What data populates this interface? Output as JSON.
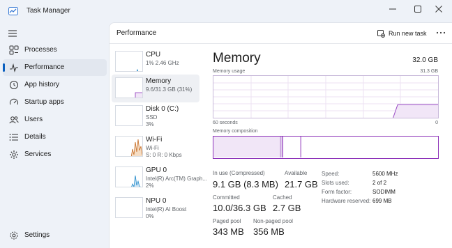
{
  "window": {
    "title": "Task Manager"
  },
  "sidebar": {
    "items": [
      {
        "label": "Processes"
      },
      {
        "label": "Performance"
      },
      {
        "label": "App history"
      },
      {
        "label": "Startup apps"
      },
      {
        "label": "Users"
      },
      {
        "label": "Details"
      },
      {
        "label": "Services"
      }
    ],
    "settings_label": "Settings",
    "active_item": "Performance"
  },
  "header": {
    "title": "Performance",
    "run_new_task": "Run new task"
  },
  "tiles": [
    {
      "name": "CPU",
      "line1": "1%  2.46 GHz",
      "line2": ""
    },
    {
      "name": "Memory",
      "line1": "9.6/31.3 GB (31%)",
      "line2": ""
    },
    {
      "name": "Disk 0 (C:)",
      "line1": "SSD",
      "line2": "3%"
    },
    {
      "name": "Wi-Fi",
      "line1": "Wi-Fi",
      "line2": "S: 0  R: 0 Kbps"
    },
    {
      "name": "GPU 0",
      "line1": "Intel(R) Arc(TM) Graph...",
      "line2": "2%"
    },
    {
      "name": "NPU 0",
      "line1": "Intel(R) AI Boost",
      "line2": "0%"
    }
  ],
  "memory": {
    "title": "Memory",
    "total": "32.0 GB",
    "usage_label": "Memory usage",
    "usage_max": "31.3 GB",
    "time_label": "60 seconds",
    "time_end": "0",
    "composition_label": "Memory composition",
    "stats": {
      "in_use_label": "In use (Compressed)",
      "in_use_value": "9.1 GB (8.3 MB)",
      "available_label": "Available",
      "available_value": "21.7 GB",
      "committed_label": "Committed",
      "committed_value": "10.0/36.3 GB",
      "cached_label": "Cached",
      "cached_value": "2.7 GB",
      "paged_label": "Paged pool",
      "paged_value": "343 MB",
      "nonpaged_label": "Non-paged pool",
      "nonpaged_value": "356 MB"
    },
    "specs": [
      {
        "label": "Speed:",
        "value": "5600 MHz"
      },
      {
        "label": "Slots used:",
        "value": "2 of 2"
      },
      {
        "label": "Form factor:",
        "value": "SODIMM"
      },
      {
        "label": "Hardware reserved:",
        "value": "699 MB"
      }
    ],
    "usage_fraction": 0.31,
    "composition": {
      "in_use_fraction": 0.3,
      "modified_fraction": 0.01,
      "standby_fraction": 0.08
    }
  },
  "colors": {
    "accent": "#0a5fbf",
    "memory_purple": "#8b2fb8",
    "memory_fill": "#f1e6f7",
    "cpu_blue": "#1a86c8",
    "wifi_orange": "#c5691f"
  }
}
